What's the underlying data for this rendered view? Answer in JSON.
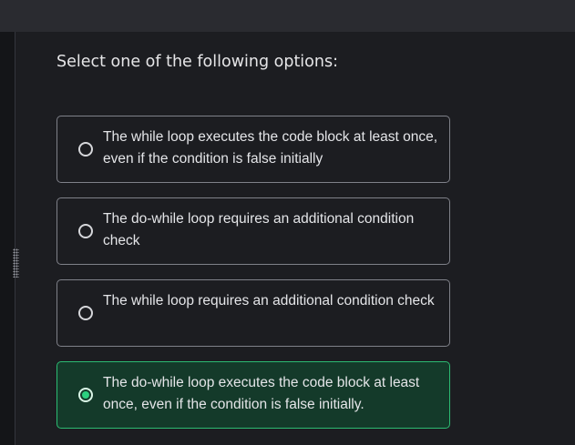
{
  "question": {
    "prompt": "Select one of the following options:"
  },
  "options": [
    {
      "label": "The while loop executes the code block at least once, even if the condition is false initially",
      "selected": false
    },
    {
      "label": "The do-while loop requires an additional condition check",
      "selected": false
    },
    {
      "label": "The while loop requires an additional condition check",
      "selected": false
    },
    {
      "label": "The do-while loop executes the code block at least once, even if the condition is false initially.",
      "selected": true
    }
  ],
  "colors": {
    "background": "#1c1d21",
    "selected_fill": "#143a2a",
    "selected_border": "#2cbb72",
    "accent": "#2cd07f"
  }
}
